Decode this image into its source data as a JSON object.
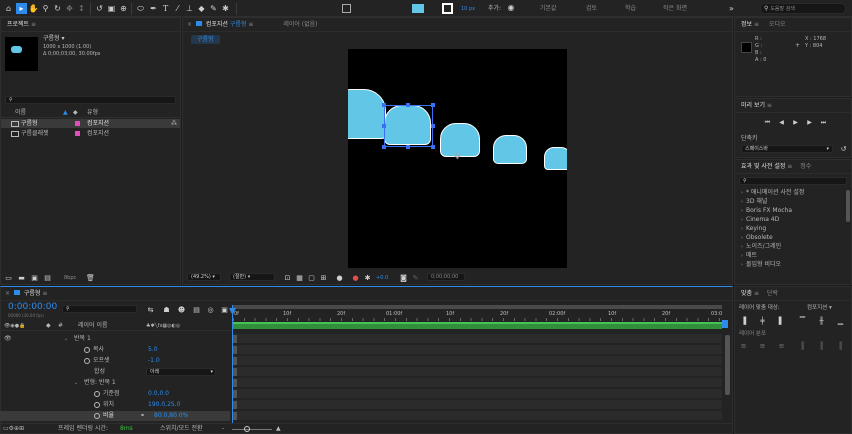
{
  "toolbar": {
    "stroke_width": "10 px",
    "add_label": "추가:",
    "workspaces": [
      "기본값",
      "검토",
      "학습",
      "작은 화면"
    ],
    "search_placeholder": "도움말 검색"
  },
  "project": {
    "title": "프로젝트",
    "item_name": "구름형 ▾",
    "item_info_1": "1000 x 1000 (1.00)",
    "item_info_2": "Δ 0;00;03;00, 30.00fps",
    "col_name": "이름",
    "col_type": "유형",
    "rows": [
      {
        "name": "구름형",
        "type": "컴포지션"
      },
      {
        "name": "구름클래젯",
        "type": "컴포지션"
      }
    ],
    "bpc": "8bpc"
  },
  "comp_viewer": {
    "tab_label": "컴포지션",
    "tab_comp": "구름형",
    "tab_layer": "레이어 (없음)",
    "breadcrumb": "구름형",
    "zoom": "(49.2%)",
    "quality": "(절반)",
    "exposure": "+0.0",
    "timecode": "0;00;00;00"
  },
  "info": {
    "tab_info": "정보",
    "tab_audio": "오디오",
    "r": "R :",
    "g": "G :",
    "b": "B :",
    "a": "A : 0",
    "x": "X : 1768",
    "y": "Y : 804"
  },
  "preview": {
    "title": "미리 보기",
    "shortcut_label": "단축키",
    "shortcut_value": "스페이스바"
  },
  "effects": {
    "title": "효과 및 사전 설정",
    "tab2": "정수",
    "items": [
      "* 애니메이션 사전 설정",
      "3D 채널",
      "Boris FX Mocha",
      "Cinema 4D",
      "Keying",
      "Obsolete",
      "노이즈/그레인",
      "매트",
      "몰입형 비디오"
    ]
  },
  "align": {
    "tab_align": "맞춤",
    "tab_tracker": "단락",
    "align_to_label": "레이어 맞춤 대상:",
    "align_to_value": "컴포지션",
    "distribute_label": "레이어 분포"
  },
  "timeline": {
    "comp_tab": "구름형",
    "timecode": "0:00:00:00",
    "timecode_sub": "00000 (30.00 fps)",
    "layer_name_col": "레이어 이름",
    "ruler": [
      "0f",
      "10f",
      "20f",
      "01:00f",
      "10f",
      "20f",
      "02:00f",
      "10f",
      "20f",
      "03:0"
    ],
    "props": [
      {
        "name": "반복 1",
        "value": ""
      },
      {
        "name": "복사",
        "value": "5.0"
      },
      {
        "name": "오프셋",
        "value": "-1.0"
      },
      {
        "name": "합성",
        "value": "아래"
      },
      {
        "name": "변형: 반복 1",
        "value": ""
      },
      {
        "name": "기준점",
        "value": "0.0,0.0"
      },
      {
        "name": "위치",
        "value": "190.0,25.0"
      },
      {
        "name": "비율",
        "value": "80.0,80.0%"
      }
    ],
    "footer_render": "프레임 렌더링 시간:",
    "footer_render_value": "8ms",
    "footer_toggle": "스위치/모드 전환"
  }
}
